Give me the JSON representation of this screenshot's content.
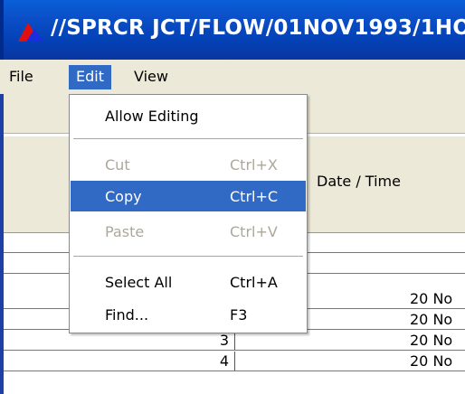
{
  "window": {
    "title": "//SPRCR JCT/FLOW/01NOV1993/1HO"
  },
  "menubar": {
    "items": [
      {
        "label": "File"
      },
      {
        "label": "Edit"
      },
      {
        "label": "View"
      }
    ],
    "active": "Edit"
  },
  "edit_menu": {
    "items": [
      {
        "label": "Allow Editing",
        "shortcut": "",
        "state": "enabled"
      },
      {
        "label": "Cut",
        "shortcut": "Ctrl+X",
        "state": "disabled"
      },
      {
        "label": "Copy",
        "shortcut": "Ctrl+C",
        "state": "highlighted"
      },
      {
        "label": "Paste",
        "shortcut": "Ctrl+V",
        "state": "disabled"
      },
      {
        "label": "Select All",
        "shortcut": "Ctrl+A",
        "state": "enabled"
      },
      {
        "label": "Find...",
        "shortcut": "F3",
        "state": "enabled"
      }
    ]
  },
  "table": {
    "columns": [
      "",
      "Date / Time"
    ],
    "rows": [
      {
        "index": "",
        "datetime": ""
      },
      {
        "index": "",
        "datetime": ""
      },
      {
        "index": "1",
        "datetime": "20 No"
      },
      {
        "index": "2",
        "datetime": "20 No"
      },
      {
        "index": "3",
        "datetime": "20 No"
      },
      {
        "index": "4",
        "datetime": "20 No"
      }
    ]
  },
  "colors": {
    "titlebar": "#0a4fc8",
    "menu_highlight": "#316ac5",
    "chrome": "#ece9d8",
    "disabled_text": "#aca899"
  }
}
